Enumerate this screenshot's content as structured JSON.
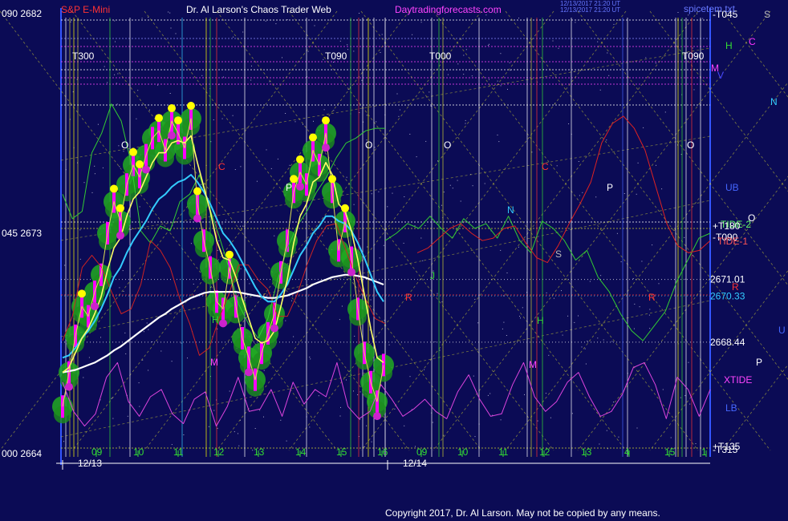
{
  "header": {
    "instrument": "S&P E-Mini",
    "title": "Dr. Al Larson's Chaos Trader Web",
    "site": "Daytradingforecasts.com",
    "stamp1": "12/13/2017 21:20 UT",
    "stamp2": "12/13/2017 21:20 UT",
    "corner": "spicetem.txt"
  },
  "copyright": "Copyright 2017, Dr. Al Larson. May not be copied by any means.",
  "colors": {
    "background": "#0b0b55",
    "price_bars": "#ff00ff",
    "ema_fast": "#ffff66",
    "ema_mid": "#33ccff",
    "ema_slow": "#ffffff",
    "green_blobs": "#22aa22",
    "yellow_dots": "#ffff00",
    "flux_purple": "#dd44dd",
    "gold_lines": "#cccc33"
  },
  "chart_data": {
    "type": "line",
    "title": "S&P E-Mini",
    "y_axis_left": {
      "labels": [
        "090 2682",
        "045 2673",
        "000 2664"
      ],
      "values": [
        2682,
        2673,
        2664
      ],
      "ylim": [
        2664,
        2682
      ]
    },
    "price_levels": [
      {
        "label": "2671.01",
        "value": 2671.01,
        "color": "#ffffff"
      },
      {
        "label": "2670.33",
        "value": 2670.33,
        "color": "#33ccff"
      },
      {
        "label": "2668.44",
        "value": 2668.44,
        "color": "#ffffff"
      }
    ],
    "x_hours_day1": [
      "09",
      "10",
      "11",
      "12",
      "13",
      "14",
      "15",
      "16"
    ],
    "x_hours_day2": [
      "09",
      "10",
      "11",
      "12",
      "13",
      "4",
      "15",
      "1"
    ],
    "dates": [
      "12/13",
      "12/14"
    ],
    "top_markers": [
      "T300",
      "T090",
      "T000",
      "T090"
    ],
    "right_labels": [
      {
        "text": "-T045",
        "color": "#ffffff"
      },
      {
        "text": "S",
        "color": "#bbbbbb"
      },
      {
        "text": "H",
        "color": "#33dd33"
      },
      {
        "text": "C",
        "color": "#ff33ff"
      },
      {
        "text": "M",
        "color": "#ff44ff"
      },
      {
        "text": "V",
        "color": "#4444ff"
      },
      {
        "text": "N",
        "color": "#33ccff"
      },
      {
        "text": "UB",
        "color": "#4466ff"
      },
      {
        "text": "O",
        "color": "#ffffff"
      },
      {
        "text": "TIDE-2",
        "color": "#66ff66"
      },
      {
        "text": "+T180",
        "color": "#ffffff"
      },
      {
        "text": "-T090",
        "color": "#ffffff"
      },
      {
        "text": "TIDE-1",
        "color": "#ff5555"
      },
      {
        "text": "R",
        "color": "#ff3333"
      },
      {
        "text": "U",
        "color": "#4466ff"
      },
      {
        "text": "P",
        "color": "#ffffff"
      },
      {
        "text": "XTIDE",
        "color": "#ff44ff"
      },
      {
        "text": "LB",
        "color": "#4466ff"
      },
      {
        "text": "+T135",
        "color": "#ffffff"
      },
      {
        "text": "-T315",
        "color": "#ffffff"
      }
    ],
    "plot_letters": [
      {
        "text": "O",
        "color": "#ffffff"
      },
      {
        "text": "O",
        "color": "#ffffff"
      },
      {
        "text": "O",
        "color": "#ffffff"
      },
      {
        "text": "O",
        "color": "#ffffff"
      },
      {
        "text": "C",
        "color": "#ff3333"
      },
      {
        "text": "C",
        "color": "#ff3333"
      },
      {
        "text": "P",
        "color": "#ffffff"
      },
      {
        "text": "P",
        "color": "#ffffff"
      },
      {
        "text": "N",
        "color": "#33ccff"
      },
      {
        "text": "S",
        "color": "#bbbbbb"
      },
      {
        "text": "H",
        "color": "#33dd33"
      },
      {
        "text": "H",
        "color": "#33dd33"
      },
      {
        "text": "M",
        "color": "#ff44ff"
      },
      {
        "text": "M",
        "color": "#ff44ff"
      },
      {
        "text": "R",
        "color": "#ff3333"
      },
      {
        "text": "R",
        "color": "#ff3333"
      },
      {
        "text": "J",
        "color": "#33dd33"
      }
    ],
    "series": [
      {
        "name": "price",
        "values": [
          2665.8,
          2667.2,
          2668.7,
          2669.9,
          2669.5,
          2670.5,
          2671.2,
          2672.9,
          2674.2,
          2673.4,
          2674.9,
          2675.7,
          2675.2,
          2676.1,
          2676.8,
          2677.1,
          2676.3,
          2677.5,
          2677.0,
          2676.4,
          2677.6,
          2674.1,
          2672.6,
          2671.5,
          2670.1,
          2669.8,
          2671.5,
          2669.9,
          2668.6,
          2667.8,
          2666.9,
          2668.0,
          2668.8,
          2669.6,
          2671.3,
          2672.6,
          2674.6,
          2675.4,
          2674.9,
          2676.3,
          2675.7,
          2677.0,
          2674.6,
          2672.2,
          2673.4,
          2671.9,
          2669.8,
          2668.0,
          2666.8,
          2666.0,
          2667.5
        ]
      },
      {
        "name": "ema_fast",
        "values": [
          2667.2,
          2667.4,
          2668.0,
          2668.6,
          2669.0,
          2669.6,
          2670.3,
          2671.4,
          2672.3,
          2672.7,
          2673.6,
          2674.3,
          2674.6,
          2675.2,
          2675.8,
          2676.2,
          2676.2,
          2676.6,
          2676.7,
          2676.6,
          2676.9,
          2675.8,
          2674.8,
          2673.8,
          2672.6,
          2671.9,
          2671.8,
          2671.1,
          2670.2,
          2669.4,
          2668.6,
          2668.4,
          2668.5,
          2668.9,
          2669.9,
          2671.0,
          2672.5,
          2673.6,
          2674.1,
          2675.0,
          2675.2,
          2675.8,
          2675.3,
          2674.1,
          2673.8,
          2673.0,
          2671.8,
          2670.4,
          2669.0,
          2667.8,
          2667.6
        ]
      },
      {
        "name": "ema_mid",
        "values": [
          2667.8,
          2667.9,
          2668.2,
          2668.6,
          2668.9,
          2669.3,
          2669.8,
          2670.4,
          2671.1,
          2671.5,
          2672.1,
          2672.6,
          2673.0,
          2673.4,
          2673.9,
          2674.3,
          2674.5,
          2674.8,
          2675.0,
          2675.1,
          2675.3,
          2675.0,
          2674.6,
          2674.1,
          2673.5,
          2672.9,
          2672.6,
          2672.2,
          2671.7,
          2671.2,
          2670.7,
          2670.3,
          2670.1,
          2670.1,
          2670.4,
          2670.8,
          2671.4,
          2672.0,
          2672.4,
          2672.9,
          2673.2,
          2673.6,
          2673.6,
          2673.4,
          2673.3,
          2673.0,
          2672.5,
          2671.9,
          2671.2,
          2670.5,
          2670.1
        ]
      },
      {
        "name": "ema_slow",
        "values": [
          2667.2,
          2667.25,
          2667.3,
          2667.4,
          2667.5,
          2667.6,
          2667.75,
          2667.9,
          2668.1,
          2668.25,
          2668.45,
          2668.65,
          2668.85,
          2669.05,
          2669.25,
          2669.45,
          2669.6,
          2669.8,
          2669.95,
          2670.1,
          2670.25,
          2670.35,
          2670.45,
          2670.5,
          2670.5,
          2670.5,
          2670.5,
          2670.5,
          2670.45,
          2670.4,
          2670.35,
          2670.3,
          2670.25,
          2670.25,
          2670.3,
          2670.35,
          2670.45,
          2670.55,
          2670.65,
          2670.8,
          2670.9,
          2671.0,
          2671.1,
          2671.15,
          2671.2,
          2671.2,
          2671.15,
          2671.1,
          2671.0,
          2670.9,
          2670.8
        ]
      },
      {
        "name": "tide_green",
        "values": [
          2674.5,
          2673.5,
          2673.8,
          2676.2,
          2677.0,
          2678.2,
          2677.5,
          2675.8,
          2673.0,
          2672.5,
          2673.2,
          2673.0,
          2674.2,
          2674.5,
          2675.3,
          2674.0,
          2672.8,
          2671.5,
          2670.0,
          2669.2,
          2668.6,
          2669.4,
          2671.0,
          2672.3,
          2673.2,
          2673.8,
          2674.6,
          2675.2,
          2676.0,
          2676.6,
          2676.8,
          2677.1,
          2677.2,
          2677.2
        ]
      },
      {
        "name": "tide_red",
        "values": [
          2668.5,
          2669.5,
          2671.5,
          2672.0,
          2671.5,
          2670.5,
          2669.6,
          2669.8,
          2670.8,
          2672.6,
          2672.2,
          2671.5,
          2670.2,
          2669.2,
          2667.9,
          2668.2,
          2669.4,
          2670.4,
          2671.6,
          2671.6,
          2671.0,
          2670.6,
          2669.5,
          2669.5,
          2670.4,
          2671.6,
          2672.6,
          2673.2,
          2673.3,
          2672.2,
          2671.1,
          2670.2,
          2669.4,
          2669.2
        ]
      },
      {
        "name": "green_future",
        "values": [
          2672.6,
          2672.9,
          2673.3,
          2673.1,
          2673.6,
          2673.1,
          2672.7,
          2673.5,
          2673.1,
          2673.3,
          2672.7,
          2673.6,
          2672.6,
          2672.1,
          2673.4,
          2673.1,
          2672.6,
          2671.8,
          2672.2,
          2671.1,
          2670.5,
          2669.6,
          2668.9,
          2668.5,
          2669.1,
          2669.7,
          2670.9,
          2671.8,
          2672.7,
          2672.9
        ]
      },
      {
        "name": "red_future",
        "values": [
          2672.1,
          2672.3,
          2672.7,
          2673.1,
          2673.3,
          2672.9,
          2672.6,
          2672.7,
          2673.1,
          2673.2,
          2672.5,
          2671.9,
          2671.7,
          2672.4,
          2673.3,
          2674.1,
          2675.0,
          2676.6,
          2677.4,
          2677.7,
          2677.2,
          2676.3,
          2674.8,
          2673.3,
          2672.4,
          2672.1,
          2672.2,
          2672.6
        ]
      },
      {
        "name": "xtide",
        "values": [
          2666.8,
          2665.6,
          2665.0,
          2665.5,
          2667.0,
          2667.6,
          2666.0,
          2665.4,
          2666.2,
          2666.5,
          2665.5,
          2665.1,
          2666.1,
          2666.4,
          2665.0,
          2665.8,
          2667.0,
          2665.6,
          2665.7,
          2666.5,
          2665.4,
          2666.8,
          2665.9,
          2666.5,
          2666.2,
          2667.6,
          2665.8,
          2665.3,
          2665.6,
          2666.7,
          2666.1,
          2665.4,
          2665.7,
          2666.1,
          2665.6,
          2665.3,
          2666.4,
          2667.1,
          2666.1,
          2665.4,
          2665.5,
          2666.7,
          2667.6,
          2666.2,
          2665.6,
          2666.0,
          2666.8,
          2667.2,
          2666.2,
          2665.4,
          2665.6,
          2666.3,
          2667.4,
          2667.6,
          2666.7,
          2665.3,
          2667.0,
          2666.5,
          2665.4,
          2666.5
        ]
      }
    ]
  }
}
